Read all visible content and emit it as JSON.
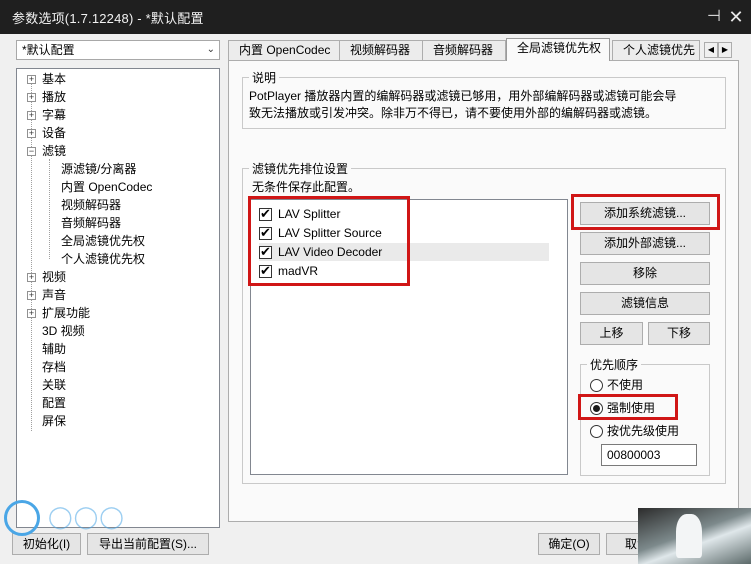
{
  "window": {
    "title": "参数选项(1.7.12248) - *默认配置",
    "pin_icon": "pin-icon",
    "close_icon": "close-icon"
  },
  "preset": {
    "value": "*默认配置"
  },
  "tree": {
    "items": [
      {
        "label": "基本",
        "expandable": true
      },
      {
        "label": "播放",
        "expandable": true
      },
      {
        "label": "字幕",
        "expandable": true
      },
      {
        "label": "设备",
        "expandable": true
      },
      {
        "label": "滤镜",
        "expandable": true,
        "expanded": true
      },
      {
        "label": "源滤镜/分离器",
        "child": true
      },
      {
        "label": "内置 OpenCodec",
        "child": true
      },
      {
        "label": "视频解码器",
        "child": true
      },
      {
        "label": "音频解码器",
        "child": true
      },
      {
        "label": "全局滤镜优先权",
        "child": true,
        "selected": true
      },
      {
        "label": "个人滤镜优先权",
        "child": true
      },
      {
        "label": "视频",
        "expandable": true
      },
      {
        "label": "声音",
        "expandable": true
      },
      {
        "label": "扩展功能",
        "expandable": true
      },
      {
        "label": "3D 视频"
      },
      {
        "label": "辅助"
      },
      {
        "label": "存档"
      },
      {
        "label": "关联"
      },
      {
        "label": "配置"
      },
      {
        "label": "屏保"
      }
    ]
  },
  "tabs": [
    {
      "label": "内置 OpenCodec"
    },
    {
      "label": "视频解码器"
    },
    {
      "label": "音频解码器"
    },
    {
      "label": "全局滤镜优先权",
      "active": true
    },
    {
      "label": "个人滤镜优先"
    }
  ],
  "description": {
    "title": "说明",
    "text_line1": "PotPlayer 播放器内置的编解码器或滤镜已够用，用外部编解码器或滤镜可能会导",
    "text_line2": "致无法播放或引发冲突。除非万不得已，请不要使用外部的编解码器或滤镜。"
  },
  "priority": {
    "title": "滤镜优先排位设置",
    "subtitle": "无条件保存此配置。",
    "filters": [
      {
        "label": "LAV Splitter",
        "checked": true
      },
      {
        "label": "LAV Splitter Source",
        "checked": true
      },
      {
        "label": "LAV Video Decoder",
        "checked": true
      },
      {
        "label": "madVR",
        "checked": true
      }
    ],
    "buttons": {
      "add_system": "添加系统滤镜...",
      "add_external": "添加外部滤镜...",
      "remove": "移除",
      "info": "滤镜信息",
      "move_up": "上移",
      "move_down": "下移"
    },
    "order": {
      "title": "优先顺序",
      "options": [
        {
          "label": "不使用",
          "selected": false
        },
        {
          "label": "强制使用",
          "selected": true
        },
        {
          "label": "按优先级使用",
          "selected": false
        }
      ],
      "level_value": "00800003"
    }
  },
  "footer": {
    "init": "初始化(I)",
    "export": "导出当前配置(S)...",
    "ok": "确定(O)",
    "cancel": "取消"
  },
  "accent_color": "#d01616"
}
